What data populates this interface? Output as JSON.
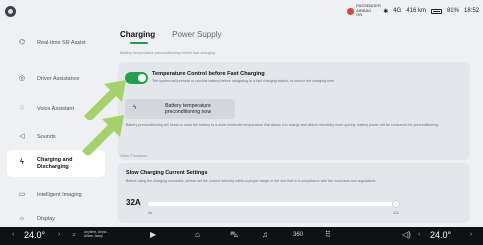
{
  "status": {
    "airbag_text": "PASSENGER AIRBAG ON",
    "bluetooth_icon": "bluetooth-icon",
    "signal": "4G",
    "range": "416 km",
    "battery": "81%",
    "time": "18:52"
  },
  "sidebar": {
    "items": [
      {
        "label": "Real-time SR Assist",
        "icon": "steering-icon"
      },
      {
        "label": "Driver Assistance",
        "icon": "assist-icon"
      },
      {
        "label": "Voice Assistant",
        "icon": "voice-icon"
      },
      {
        "label": "Sounds",
        "icon": "speaker-icon"
      },
      {
        "label": "Charging and Discharging",
        "icon": "charging-icon"
      },
      {
        "label": "Intelligent Imaging",
        "icon": "camera-icon"
      },
      {
        "label": "Display",
        "icon": "display-icon"
      }
    ]
  },
  "tabs": [
    "Charging",
    "Power Supply"
  ],
  "main": {
    "caption": "Battery temperature preconditioning before fast charging",
    "temp_control_title": "Temperature Control before Fast Charging",
    "temp_control_desc": "The system will preheat or cool the battery before navigating to a fast charging station, to reduce the charging time",
    "precon_label": "Battery temperature preconditioning now",
    "precon_desc": "Battery preconditioning will heats or cools the battery to a more moderate temperature that allows it to charge and deliver electricity more quickly, battery power will be consumed for preconditioning.",
    "other_caption": "Other Functions",
    "slow_title": "Slow Charging Current Settings",
    "slow_desc": "Before using the charging connector, please set the current intensity within a proper range or the one that is in compliance with the local laws and regulations.",
    "current_value": "32A",
    "slider_min": "6A",
    "slider_max": "32A",
    "slider_fraction": 1.0,
    "toggle_on": true
  },
  "dock": {
    "left_temp": "24.0°",
    "right_temp": "24.0°",
    "media_title": "Anytime, Anyw...",
    "media_artist": "Alisen Jacky",
    "icons": [
      "play-icon",
      "home-icon",
      "car-icon",
      "music-icon",
      "360-icon",
      "apps-icon",
      "volume-icon"
    ]
  }
}
